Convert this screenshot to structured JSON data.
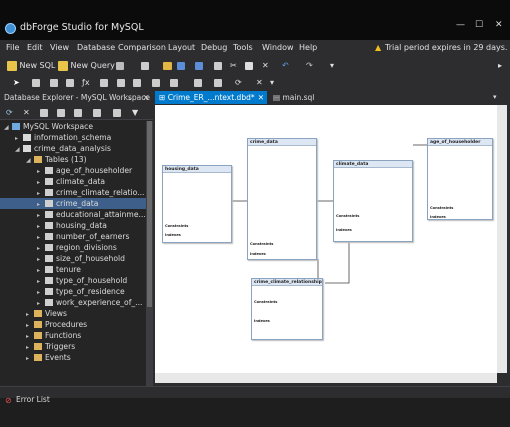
{
  "app": {
    "title": "dbForge Studio for MySQL"
  },
  "window_controls": {
    "minimize": "—",
    "maximize": "☐",
    "close": "✕"
  },
  "menu": [
    "File",
    "Edit",
    "View",
    "Database",
    "Comparison",
    "Layout",
    "Debug",
    "Tools",
    "Window",
    "Help"
  ],
  "trial": {
    "text": "Trial period expires in 29 days."
  },
  "toolbar": {
    "new_sql": "New SQL",
    "new_query": "New Query"
  },
  "explorer": {
    "header": "Database Explorer - MySQL Workspace",
    "tree": [
      {
        "label": "MySQL Workspace",
        "level": 0,
        "expander": "◢",
        "icon": "server-icon",
        "selected": false
      },
      {
        "label": "information_schema",
        "level": 1,
        "expander": "▸",
        "icon": "database-icon",
        "selected": false
      },
      {
        "label": "crime_data_analysis",
        "level": 1,
        "expander": "◢",
        "icon": "database-icon",
        "selected": false
      },
      {
        "label": "Tables (13)",
        "level": 2,
        "expander": "◢",
        "icon": "folder-icon",
        "selected": false
      },
      {
        "label": "age_of_householder",
        "level": 3,
        "expander": "▸",
        "icon": "table-icon",
        "selected": false
      },
      {
        "label": "climate_data",
        "level": 3,
        "expander": "▸",
        "icon": "table-icon",
        "selected": false
      },
      {
        "label": "crime_climate_relatio...",
        "level": 3,
        "expander": "▸",
        "icon": "table-icon",
        "selected": false
      },
      {
        "label": "crime_data",
        "level": 3,
        "expander": "▸",
        "icon": "table-icon",
        "selected": true
      },
      {
        "label": "educational_attainme...",
        "level": 3,
        "expander": "▸",
        "icon": "table-icon",
        "selected": false
      },
      {
        "label": "housing_data",
        "level": 3,
        "expander": "▸",
        "icon": "table-icon",
        "selected": false
      },
      {
        "label": "number_of_earners",
        "level": 3,
        "expander": "▸",
        "icon": "table-icon",
        "selected": false
      },
      {
        "label": "region_divisions",
        "level": 3,
        "expander": "▸",
        "icon": "table-icon",
        "selected": false
      },
      {
        "label": "size_of_household",
        "level": 3,
        "expander": "▸",
        "icon": "table-icon",
        "selected": false
      },
      {
        "label": "tenure",
        "level": 3,
        "expander": "▸",
        "icon": "table-icon",
        "selected": false
      },
      {
        "label": "type_of_household",
        "level": 3,
        "expander": "▸",
        "icon": "table-icon",
        "selected": false
      },
      {
        "label": "type_of_residence",
        "level": 3,
        "expander": "▸",
        "icon": "table-icon",
        "selected": false
      },
      {
        "label": "work_experience_of_...",
        "level": 3,
        "expander": "▸",
        "icon": "table-icon",
        "selected": false
      },
      {
        "label": "Views",
        "level": 2,
        "expander": "▸",
        "icon": "folder-icon",
        "selected": false
      },
      {
        "label": "Procedures",
        "level": 2,
        "expander": "▸",
        "icon": "folder-icon",
        "selected": false
      },
      {
        "label": "Functions",
        "level": 2,
        "expander": "▸",
        "icon": "folder-icon",
        "selected": false
      },
      {
        "label": "Triggers",
        "level": 2,
        "expander": "▸",
        "icon": "folder-icon",
        "selected": false
      },
      {
        "label": "Events",
        "level": 2,
        "expander": "▸",
        "icon": "folder-icon",
        "selected": false
      }
    ]
  },
  "tabs": [
    {
      "label": "Crime_ER_...ntext.dbd*",
      "active": true,
      "close": "✕"
    },
    {
      "label": "main.sql",
      "active": false,
      "close": ""
    }
  ],
  "bottom": {
    "error_list": "Error List"
  },
  "colors": {
    "accent": "#007acc",
    "selection": "#3e5f8a",
    "warning": "#f0c020"
  }
}
